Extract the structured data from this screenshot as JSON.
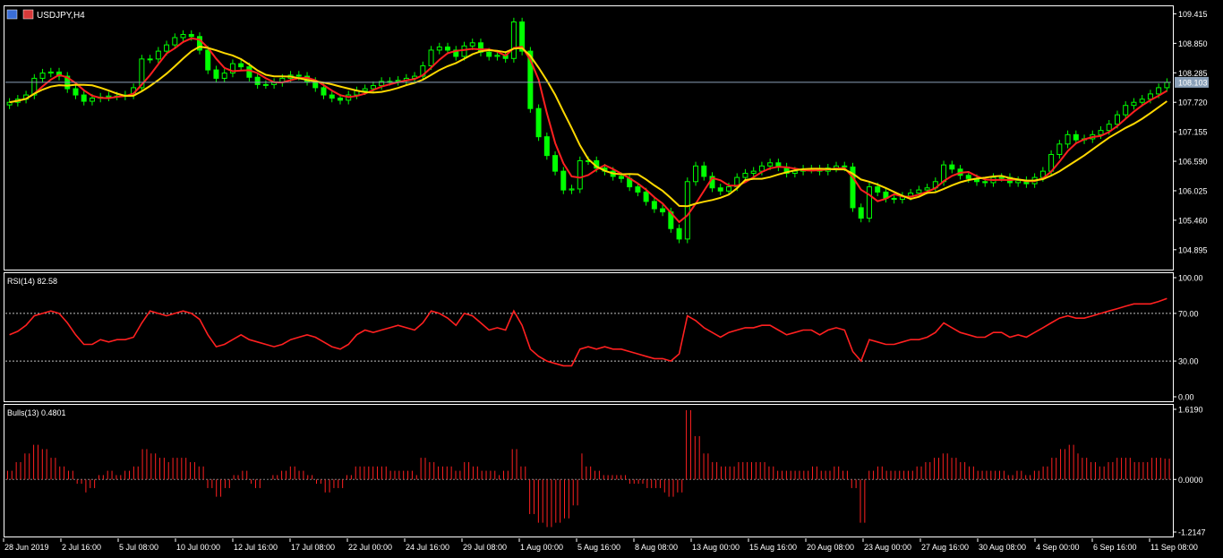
{
  "window": {
    "title": "USDJPY,H4",
    "icons": [
      "candles-icon",
      "properties-icon"
    ]
  },
  "colors": {
    "background": "#000000",
    "bull_candle": "#00ff00",
    "ma_fast": "#ff2020",
    "ma_slow": "#ffd800",
    "rsi_line": "#ff2020",
    "bulls_hist": "#ff2020",
    "price_line": "#8aa0b8",
    "axis": "#ffffff"
  },
  "chart_data": [
    {
      "type": "candlestick",
      "title": "USDJPY,H4",
      "symbol": "USDJPY",
      "timeframe": "H4",
      "current_price": "108.103",
      "y_ticks": [
        "109.415",
        "108.850",
        "108.285",
        "107.720",
        "107.155",
        "106.590",
        "106.025",
        "105.460",
        "104.895"
      ],
      "ylim": [
        104.6,
        109.44
      ],
      "series": [
        {
          "name": "Close",
          "values": [
            107.72,
            107.78,
            107.86,
            108.18,
            108.28,
            108.3,
            108.22,
            107.98,
            107.86,
            107.74,
            107.8,
            107.82,
            107.84,
            107.84,
            107.86,
            108.0,
            108.55,
            108.55,
            108.7,
            108.82,
            108.96,
            109.02,
            108.98,
            108.72,
            108.34,
            108.18,
            108.28,
            108.46,
            108.4,
            108.2,
            108.06,
            108.06,
            108.1,
            108.18,
            108.24,
            108.22,
            108.12,
            108.0,
            107.86,
            107.8,
            107.76,
            107.86,
            107.94,
            107.98,
            108.04,
            108.12,
            108.12,
            108.14,
            108.18,
            108.22,
            108.42,
            108.72,
            108.78,
            108.72,
            108.6,
            108.8,
            108.86,
            108.68,
            108.6,
            108.62,
            108.56,
            109.26,
            108.7,
            107.6,
            107.06,
            106.7,
            106.4,
            106.04,
            106.06,
            106.6,
            106.6,
            106.46,
            106.4,
            106.3,
            106.26,
            106.1,
            106.0,
            105.82,
            105.68,
            105.62,
            105.3,
            105.1,
            106.2,
            106.5,
            106.3,
            106.08,
            106.02,
            106.1,
            106.28,
            106.36,
            106.4,
            106.5,
            106.56,
            106.48,
            106.36,
            106.4,
            106.44,
            106.44,
            106.4,
            106.46,
            106.5,
            106.48,
            105.7,
            105.5,
            106.1,
            106.0,
            105.88,
            105.86,
            105.92,
            105.98,
            106.04,
            106.08,
            106.2,
            106.52,
            106.44,
            106.32,
            106.26,
            106.2,
            106.18,
            106.28,
            106.28,
            106.18,
            106.22,
            106.16,
            106.28,
            106.4,
            106.72,
            106.92,
            107.1,
            107.0,
            107.02,
            107.1,
            107.18,
            107.3,
            107.48,
            107.66,
            107.72,
            107.78,
            107.88,
            108.0,
            108.1
          ]
        }
      ]
    },
    {
      "type": "line",
      "title": "RSI(14) 82.58",
      "indicator": "RSI",
      "period": 14,
      "last_value": 82.58,
      "y_ticks": [
        "100.00",
        "70.00",
        "30.00",
        "0.00"
      ],
      "ylim": [
        0,
        100
      ],
      "levels": [
        70,
        30
      ],
      "series": [
        {
          "name": "RSI(14)",
          "values": [
            52,
            55,
            60,
            68,
            70,
            72,
            70,
            62,
            52,
            44,
            44,
            48,
            46,
            48,
            48,
            50,
            62,
            72,
            70,
            68,
            70,
            72,
            70,
            65,
            52,
            42,
            44,
            48,
            52,
            48,
            46,
            44,
            42,
            44,
            48,
            50,
            52,
            50,
            46,
            42,
            40,
            44,
            52,
            56,
            54,
            56,
            58,
            60,
            58,
            56,
            62,
            72,
            70,
            66,
            60,
            70,
            68,
            62,
            56,
            58,
            56,
            72,
            60,
            40,
            34,
            30,
            28,
            26,
            26,
            40,
            42,
            40,
            42,
            40,
            40,
            38,
            36,
            34,
            32,
            32,
            30,
            36,
            68,
            64,
            58,
            54,
            50,
            54,
            56,
            58,
            58,
            60,
            60,
            56,
            52,
            54,
            56,
            56,
            52,
            56,
            58,
            56,
            38,
            30,
            48,
            46,
            44,
            44,
            46,
            48,
            48,
            50,
            54,
            62,
            58,
            54,
            52,
            50,
            50,
            54,
            54,
            50,
            52,
            50,
            54,
            58,
            62,
            66,
            68,
            66,
            66,
            68,
            70,
            72,
            74,
            76,
            78,
            78,
            78,
            80,
            82.58
          ]
        }
      ]
    },
    {
      "type": "bar",
      "title": "Bulls(13) 0.4801",
      "indicator": "Bulls Power",
      "period": 13,
      "last_value": 0.4801,
      "y_ticks": [
        "1.6190",
        "0.0000",
        "-1.2147"
      ],
      "ylim": [
        -1.2147,
        1.619
      ],
      "series": [
        {
          "name": "Bulls(13)",
          "values": [
            0.2,
            0.4,
            0.6,
            0.8,
            0.7,
            0.5,
            0.3,
            0.2,
            -0.1,
            -0.3,
            -0.2,
            0.1,
            0.2,
            0.1,
            0.2,
            0.3,
            0.7,
            0.6,
            0.5,
            0.4,
            0.5,
            0.5,
            0.4,
            0.3,
            -0.2,
            -0.4,
            -0.2,
            0.1,
            0.2,
            -0.1,
            -0.2,
            0.0,
            0.1,
            0.2,
            0.3,
            0.2,
            0.1,
            -0.1,
            -0.3,
            -0.2,
            -0.2,
            0.1,
            0.3,
            0.3,
            0.3,
            0.3,
            0.2,
            0.2,
            0.2,
            0.1,
            0.5,
            0.4,
            0.3,
            0.3,
            0.2,
            0.4,
            0.3,
            0.2,
            0.2,
            0.1,
            0.2,
            0.7,
            0.3,
            -0.8,
            -1.0,
            -1.1,
            -1.0,
            -0.9,
            -0.6,
            0.6,
            0.3,
            0.2,
            0.1,
            0.1,
            0.1,
            -0.1,
            -0.1,
            -0.2,
            -0.2,
            -0.3,
            -0.4,
            -0.3,
            1.6,
            1.0,
            0.6,
            0.4,
            0.3,
            0.3,
            0.4,
            0.4,
            0.4,
            0.4,
            0.3,
            0.2,
            0.2,
            0.2,
            0.2,
            0.3,
            0.2,
            0.2,
            0.3,
            0.2,
            -0.2,
            -1.0,
            0.2,
            0.3,
            0.2,
            0.2,
            0.2,
            0.2,
            0.3,
            0.4,
            0.5,
            0.6,
            0.5,
            0.4,
            0.3,
            0.2,
            0.2,
            0.2,
            0.2,
            0.1,
            0.2,
            0.1,
            0.2,
            0.3,
            0.5,
            0.7,
            0.8,
            0.6,
            0.5,
            0.4,
            0.3,
            0.4,
            0.5,
            0.5,
            0.4,
            0.4,
            0.5,
            0.5,
            0.4801
          ]
        }
      ]
    }
  ],
  "time_axis": {
    "labels": [
      "28 Jun 2019",
      "2 Jul 16:00",
      "5 Jul 08:00",
      "10 Jul 00:00",
      "12 Jul 16:00",
      "17 Jul 08:00",
      "22 Jul 00:00",
      "24 Jul 16:00",
      "29 Jul 08:00",
      "1 Aug 00:00",
      "5 Aug 16:00",
      "8 Aug 08:00",
      "13 Aug 00:00",
      "15 Aug 16:00",
      "20 Aug 08:00",
      "23 Aug 00:00",
      "27 Aug 16:00",
      "30 Aug 08:00",
      "4 Sep 00:00",
      "6 Sep 16:00",
      "11 Sep 08:00"
    ]
  }
}
